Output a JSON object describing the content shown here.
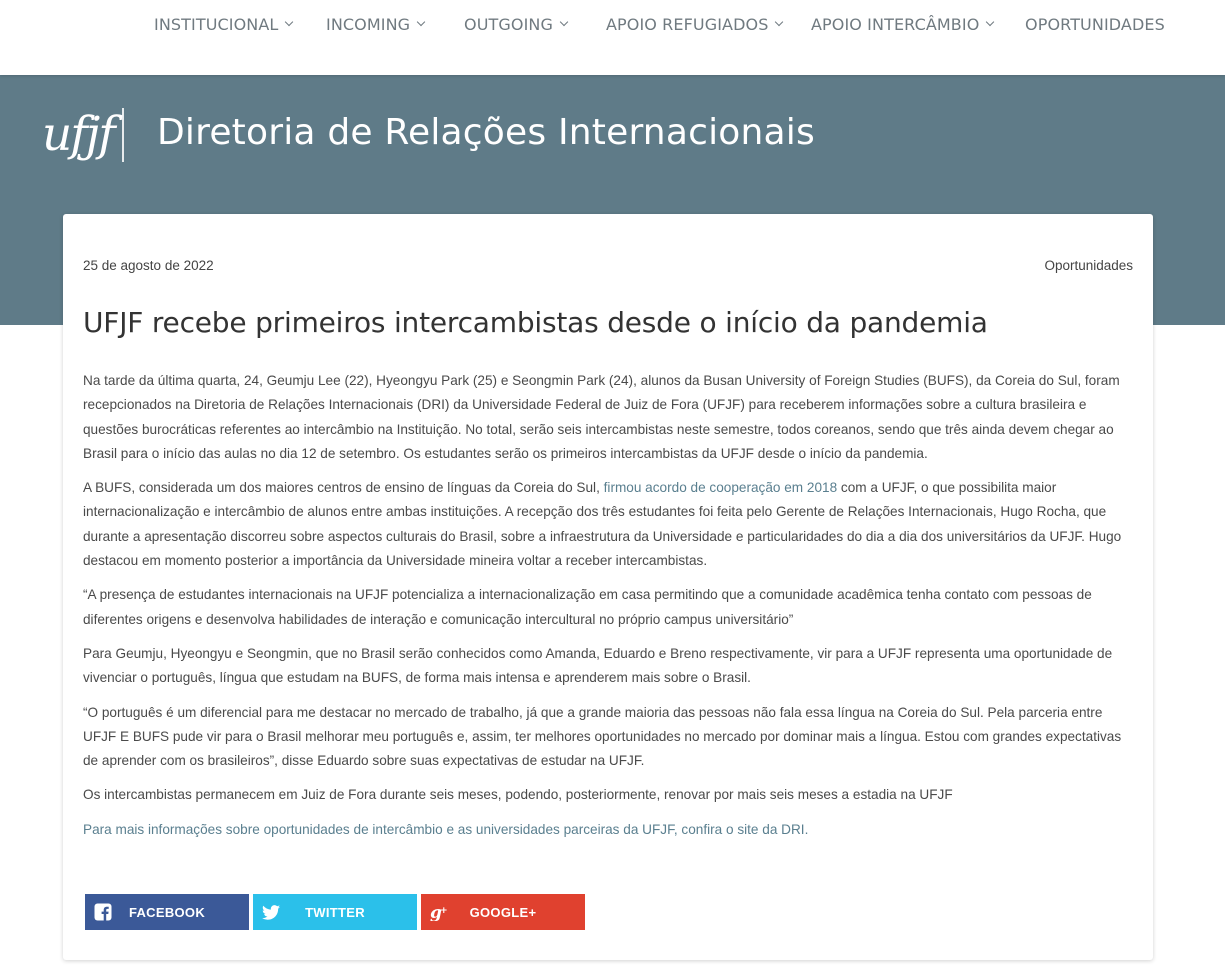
{
  "nav": {
    "items": [
      {
        "label": "INSTITUCIONAL",
        "dropdown": true
      },
      {
        "label": "INCOMING",
        "dropdown": true
      },
      {
        "label": "OUTGOING",
        "dropdown": true
      },
      {
        "label": "APOIO REFUGIADOS",
        "dropdown": true
      },
      {
        "label": "APOIO INTERCÂMBIO",
        "dropdown": true
      },
      {
        "label": "OPORTUNIDADES",
        "dropdown": false
      }
    ]
  },
  "header": {
    "logo_text": "ufjf",
    "site_title": "Diretoria de Relações Internacionais",
    "band_color": "#5f7b88"
  },
  "article": {
    "date": "25 de agosto de 2022",
    "category": "Oportunidades",
    "title": "UFJF recebe primeiros intercambistas desde o início da pandemia",
    "p1": "Na tarde da última quarta, 24, Geumju Lee (22), Hyeongyu Park (25) e Seongmin Park (24), alunos da Busan University of Foreign Studies (BUFS), da Coreia do Sul, foram recepcionados na Diretoria de Relações Internacionais (DRI) da Universidade Federal de Juiz de Fora (UFJF) para receberem informações sobre a cultura brasileira e questões burocráticas referentes  ao intercâmbio na Instituição. No total, serão seis intercambistas neste semestre, todos coreanos, sendo que três ainda devem chegar ao Brasil para o início das aulas no dia 12 de setembro. Os estudantes serão os primeiros intercambistas da UFJF desde o início da pandemia.",
    "p2_before": "A BUFS, considerada um dos maiores centros de ensino de línguas da Coreia do Sul, ",
    "p2_link": "firmou  acordo de cooperação em 2018",
    "p2_after": " com a UFJF, o que possibilita maior internacionalização e intercâmbio de alunos entre ambas instituições. A recepção dos três estudantes foi feita pelo Gerente de Relações Internacionais, Hugo Rocha, que durante a apresentação discorreu sobre aspectos culturais do Brasil, sobre a infraestrutura da Universidade e particularidades do dia a dia dos universitários da UFJF. Hugo destacou em momento posterior a importância da Universidade mineira voltar a receber intercambistas.",
    "p3": "“A presença de estudantes internacionais na UFJF potencializa a internacionalização em casa permitindo que a comunidade acadêmica tenha contato com pessoas de diferentes origens e desenvolva habilidades de interação e comunicação intercultural no próprio campus universitário”",
    "p4": "Para Geumju, Hyeongyu e Seongmin, que no Brasil serão conhecidos como Amanda, Eduardo e Breno respectivamente, vir para a UFJF representa uma oportunidade de vivenciar o português, língua que estudam na BUFS, de forma mais intensa e aprenderem mais sobre o Brasil.",
    "p5": "“O português é um diferencial para me destacar no mercado de trabalho, já que a grande maioria das pessoas não fala essa língua na Coreia do Sul. Pela parceria entre UFJF E BUFS pude vir para o Brasil melhorar meu português e, assim, ter melhores oportunidades no mercado por dominar mais a língua. Estou com grandes expectativas de aprender com os brasileiros”, disse Eduardo sobre suas expectativas de estudar na UFJF.",
    "p6": "Os intercambistas permanecem em Juiz de Fora durante seis meses, podendo, posteriormente, renovar por mais seis meses a  estadia na UFJF",
    "p7_link": "Para mais informações sobre oportunidades de intercâmbio e as universidades parceiras da UFJF, confira o site da DRI."
  },
  "share": {
    "facebook": {
      "label": "FACEBOOK",
      "icon": "facebook-icon",
      "color": "#3b5998"
    },
    "twitter": {
      "label": "TWITTER",
      "icon": "twitter-icon",
      "color": "#2bc0ea"
    },
    "google": {
      "label": "GOOGLE+",
      "icon": "google-plus-icon",
      "color": "#e0412f"
    }
  }
}
